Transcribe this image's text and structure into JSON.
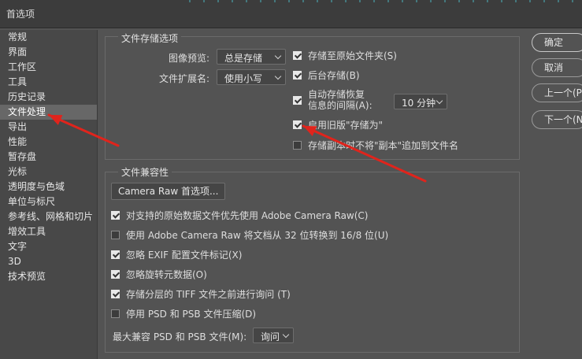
{
  "window": {
    "title": "首选项"
  },
  "sidebar": {
    "items": [
      {
        "label": "常规"
      },
      {
        "label": "界面"
      },
      {
        "label": "工作区"
      },
      {
        "label": "工具"
      },
      {
        "label": "历史记录"
      },
      {
        "label": "文件处理",
        "selected": true
      },
      {
        "label": "导出"
      },
      {
        "label": "性能"
      },
      {
        "label": "暂存盘"
      },
      {
        "label": "光标"
      },
      {
        "label": "透明度与色域"
      },
      {
        "label": "单位与标尺"
      },
      {
        "label": "参考线、网格和切片"
      },
      {
        "label": "增效工具"
      },
      {
        "label": "文字"
      },
      {
        "label": "3D"
      },
      {
        "label": "技术预览"
      }
    ]
  },
  "file_save": {
    "group_label": "文件存储选项",
    "image_preview": {
      "label": "图像预览:",
      "value": "总是存储"
    },
    "file_extension": {
      "label": "文件扩展名:",
      "value": "使用小写"
    },
    "save_to_original": {
      "label": "存储至原始文件夹(S)",
      "checked": true
    },
    "background_save": {
      "label": "后台存储(B)",
      "checked": true
    },
    "autosave": {
      "label_line1": "自动存储恢复",
      "label_line2": "信息的间隔(A):",
      "checked": true,
      "interval": "10 分钟"
    },
    "legacy_save_as": {
      "label": "启用旧版\"存储为\"",
      "checked": true
    },
    "no_copy_suffix": {
      "label": "存储副本时不将\"副本\"追加到文件名",
      "checked": false
    }
  },
  "compat": {
    "group_label": "文件兼容性",
    "camera_raw_button": "Camera Raw 首选项...",
    "options": [
      {
        "label": "对支持的原始数据文件优先使用 Adobe Camera Raw(C)",
        "checked": true
      },
      {
        "label": "使用 Adobe Camera Raw 将文档从 32 位转换到 16/8 位(U)",
        "checked": false
      },
      {
        "label": "忽略 EXIF 配置文件标记(X)",
        "checked": true
      },
      {
        "label": "忽略旋转元数据(O)",
        "checked": true
      },
      {
        "label": "存储分层的 TIFF 文件之前进行询问 (T)",
        "checked": true
      },
      {
        "label": "停用 PSD 和 PSB 文件压缩(D)",
        "checked": false
      }
    ],
    "max_compat": {
      "label": "最大兼容 PSD 和 PSB 文件(M):",
      "value": "询问"
    }
  },
  "buttons": {
    "ok": "确定",
    "cancel": "取消",
    "prev": "上一个(P)",
    "next": "下一个(N)"
  },
  "colors": {
    "annotation_arrow": "#e0241c",
    "panel_bg": "#535353",
    "sidebar_selected": "#676767"
  }
}
